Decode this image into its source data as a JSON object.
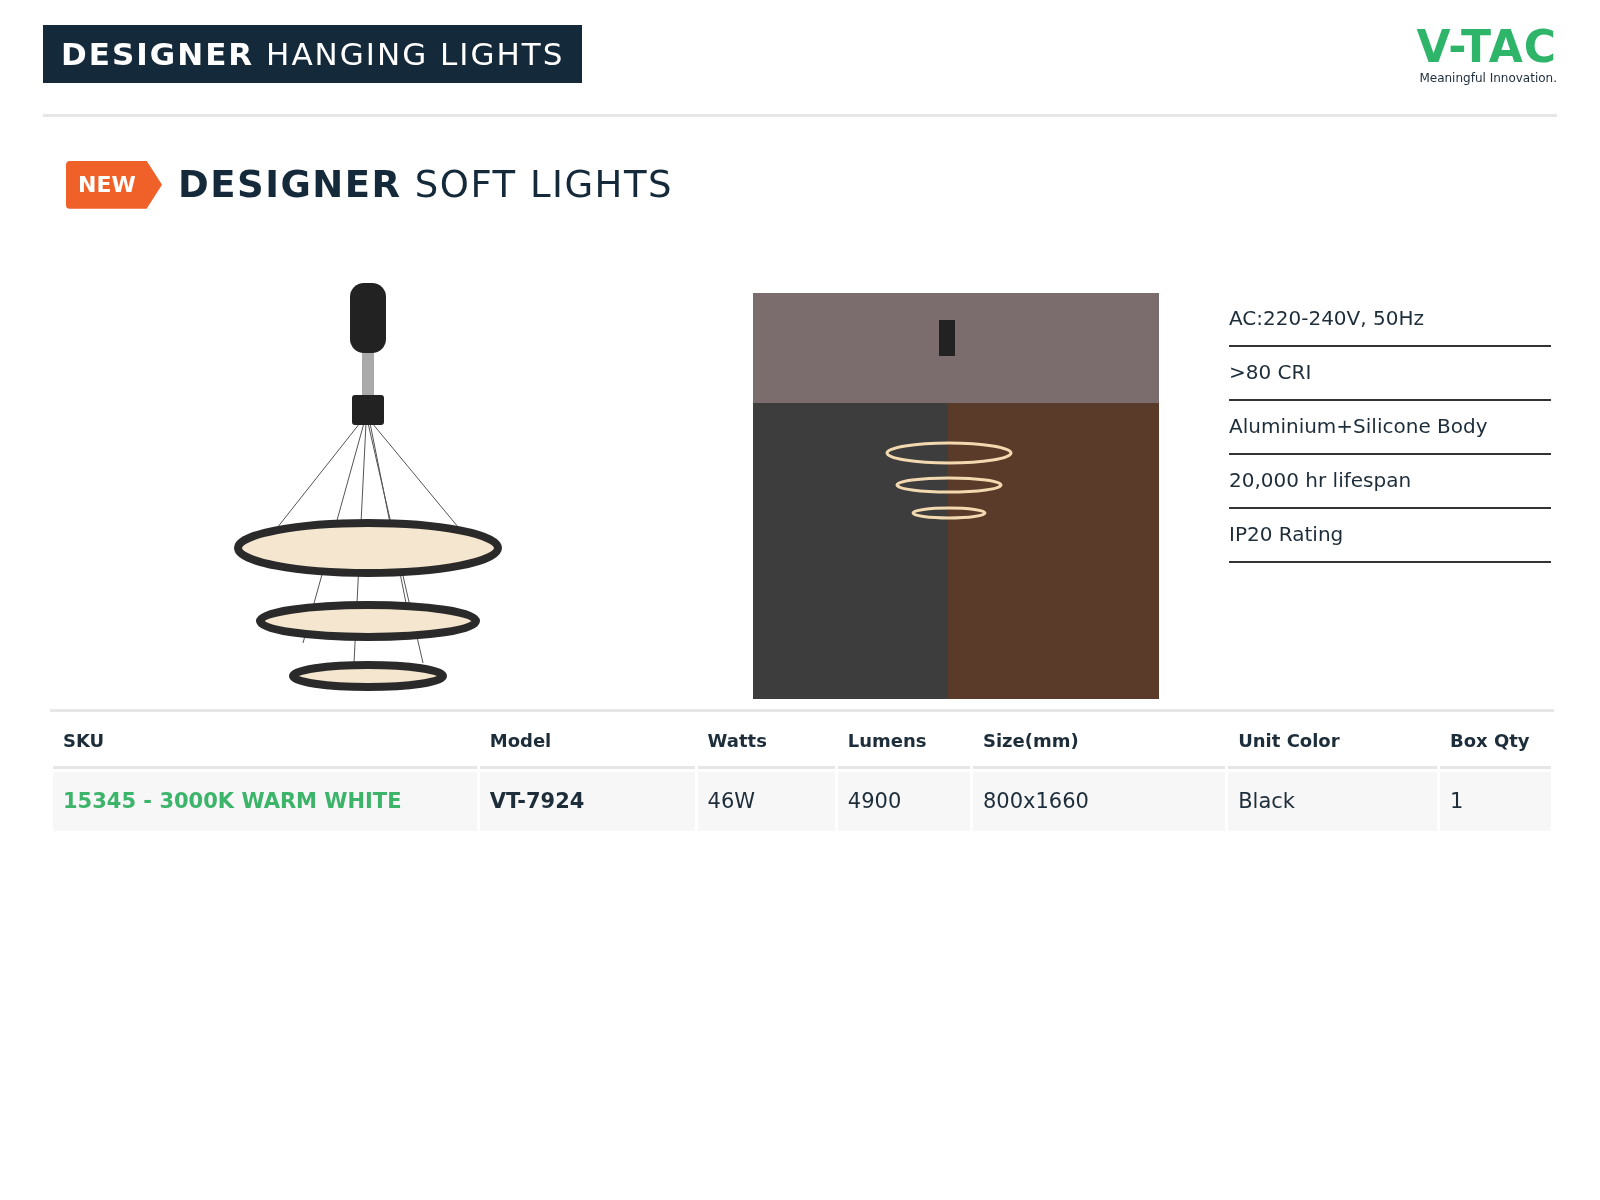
{
  "header": {
    "title_bold": "DESIGNER",
    "title_rest": "HANGING LIGHTS"
  },
  "logo": {
    "brand": "V-TAC",
    "tagline": "Meaningful Innovation."
  },
  "section": {
    "badge": "NEW",
    "title_bold": "DESIGNER",
    "title_rest": "SOFT LIGHTS"
  },
  "specs": [
    "AC:220-240V, 50Hz",
    ">80  CRI",
    "Aluminium+Silicone Body",
    "20,000 hr lifespan",
    "IP20 Rating"
  ],
  "table": {
    "columns": [
      "SKU",
      "Model",
      "Watts",
      "Lumens",
      "Size(mm)",
      "Unit Color",
      "Box Qty"
    ],
    "rows": [
      [
        "15345 - 3000K WARM WHITE",
        "VT-7924",
        "46W",
        "4900",
        "800x1660",
        "Black",
        "1"
      ]
    ]
  }
}
